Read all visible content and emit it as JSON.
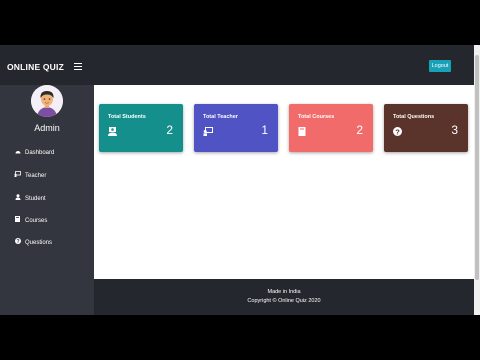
{
  "brand": "ONLINE QUIZ",
  "header": {
    "logout_label": "Logout"
  },
  "sidebar": {
    "user_name": "Admin",
    "items": [
      {
        "label": "Dashboard",
        "icon": "dashboard-icon"
      },
      {
        "label": "Teacher",
        "icon": "teacher-icon"
      },
      {
        "label": "Student",
        "icon": "student-icon"
      },
      {
        "label": "Courses",
        "icon": "book-icon"
      },
      {
        "label": "Questions",
        "icon": "question-circle-icon"
      }
    ]
  },
  "cards": [
    {
      "title": "Total Students",
      "value": "2",
      "color": "#148f8c",
      "icon": "student-icon"
    },
    {
      "title": "Total Teacher",
      "value": "1",
      "color": "#4f53c4",
      "icon": "teacher-icon"
    },
    {
      "title": "Total Courses",
      "value": "2",
      "color": "#f26b6b",
      "icon": "book-icon"
    },
    {
      "title": "Total Questions",
      "value": "3",
      "color": "#5a342a",
      "icon": "question-circle-icon"
    }
  ],
  "footer": {
    "line1": "Made in India",
    "line2": "Copyright © Online Quiz 2020"
  },
  "colors": {
    "topbar": "#24272d",
    "sidebar": "#33363e",
    "logout": "#17a2b8"
  }
}
